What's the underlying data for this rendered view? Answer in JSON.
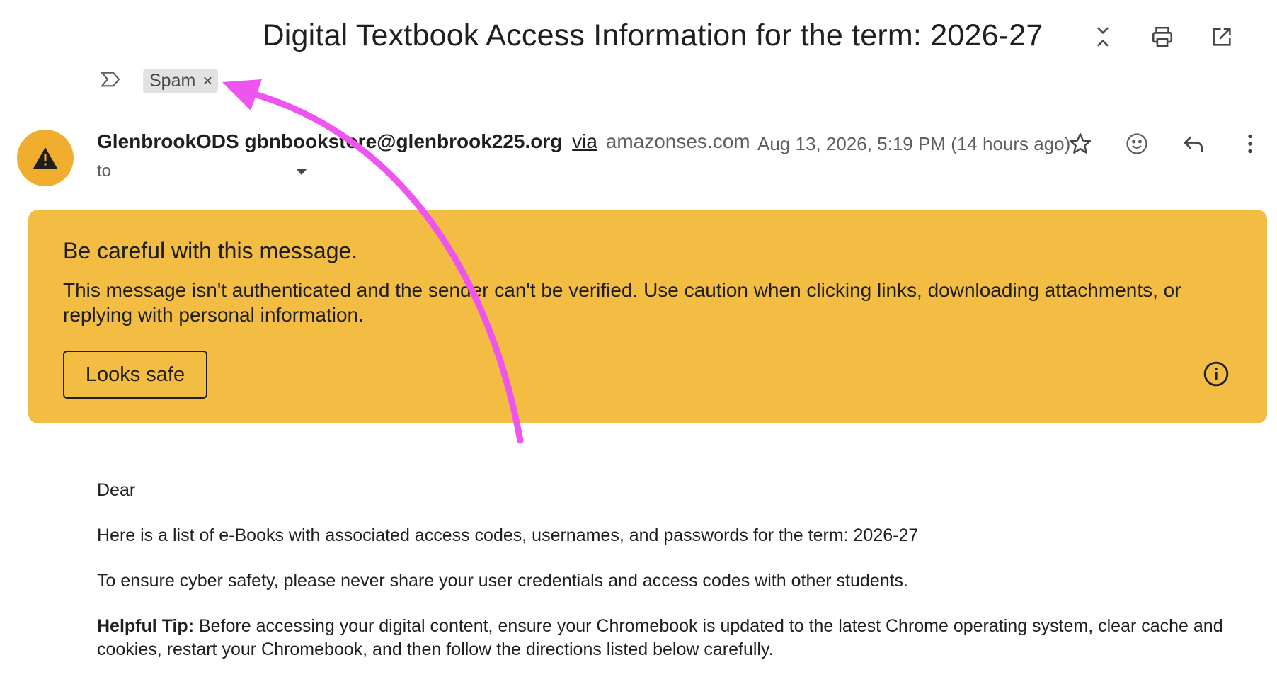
{
  "email": {
    "subject": "Digital Textbook Access Information for the term: 2026-27",
    "label": "Spam",
    "label_remove": "×",
    "sender_name": "GlenbrookODS",
    "sender_email": "gbnbookstore@glenbrook225.org",
    "via_label": "via",
    "via_domain": "amazonses.com",
    "to_label": "to",
    "date": "Aug 13, 2026, 5:19 PM (14 hours ago)"
  },
  "header_icons": [
    "collapse-all-icon",
    "print-icon",
    "open-in-new-window-icon"
  ],
  "row_icons": [
    "star-icon",
    "emoji-reaction-icon",
    "reply-icon",
    "more-options-icon"
  ],
  "warning": {
    "title": "Be careful with this message.",
    "body": "This message isn't authenticated and the sender can't be verified. Use caution when clicking links, downloading attachments, or replying with personal information.",
    "button": "Looks safe"
  },
  "body": {
    "greeting": "Dear",
    "line1": "Here is a list of e-Books with associated access codes, usernames, and passwords for the term: 2026-27",
    "line2": "To ensure cyber safety, please never share your user credentials and access codes with other students.",
    "tip_label": "Helpful Tip:",
    "tip_text": " Before accessing your digital content, ensure your Chromebook is updated to the latest Chrome operating system, clear cache and cookies, restart your Chromebook, and then follow the directions listed below carefully."
  },
  "colors": {
    "warning_bg": "#f2bd42",
    "avatar_bg": "#f0ad2e",
    "annotation_arrow": "#ee55ee"
  }
}
